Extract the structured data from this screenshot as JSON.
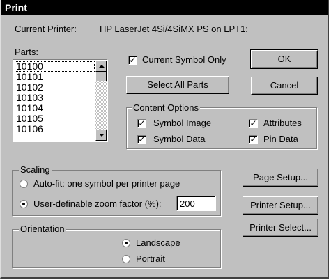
{
  "window": {
    "title": "Print"
  },
  "printer": {
    "label": "Current Printer:",
    "name": "HP LaserJet 4Si/4SiMX PS on LPT1:"
  },
  "parts": {
    "label": "Parts:",
    "items": [
      "10100",
      "10101",
      "10102",
      "10103",
      "10104",
      "10105",
      "10106"
    ],
    "selected": "10100"
  },
  "options": {
    "current_symbol_only": {
      "label": "Current Symbol Only",
      "checked": true
    }
  },
  "buttons": {
    "ok": "OK",
    "select_all_parts": "Select All Parts",
    "cancel": "Cancel",
    "page_setup": "Page Setup...",
    "printer_setup": "Printer Setup...",
    "printer_select": "Printer Select..."
  },
  "content_options": {
    "title": "Content Options",
    "symbol_image": {
      "label": "Symbol Image",
      "checked": true
    },
    "symbol_data": {
      "label": "Symbol Data",
      "checked": true
    },
    "attributes": {
      "label": "Attributes",
      "checked": true
    },
    "pin_data": {
      "label": "Pin Data",
      "checked": true
    }
  },
  "scaling": {
    "title": "Scaling",
    "auto_fit": {
      "label": "Auto-fit: one symbol per printer page",
      "selected": false
    },
    "user_zoom": {
      "label": "User-definable zoom factor (%):",
      "selected": true
    },
    "zoom_value": "200"
  },
  "orientation": {
    "title": "Orientation",
    "landscape": {
      "label": "Landscape",
      "selected": true
    },
    "portrait": {
      "label": "Portrait",
      "selected": false
    }
  }
}
